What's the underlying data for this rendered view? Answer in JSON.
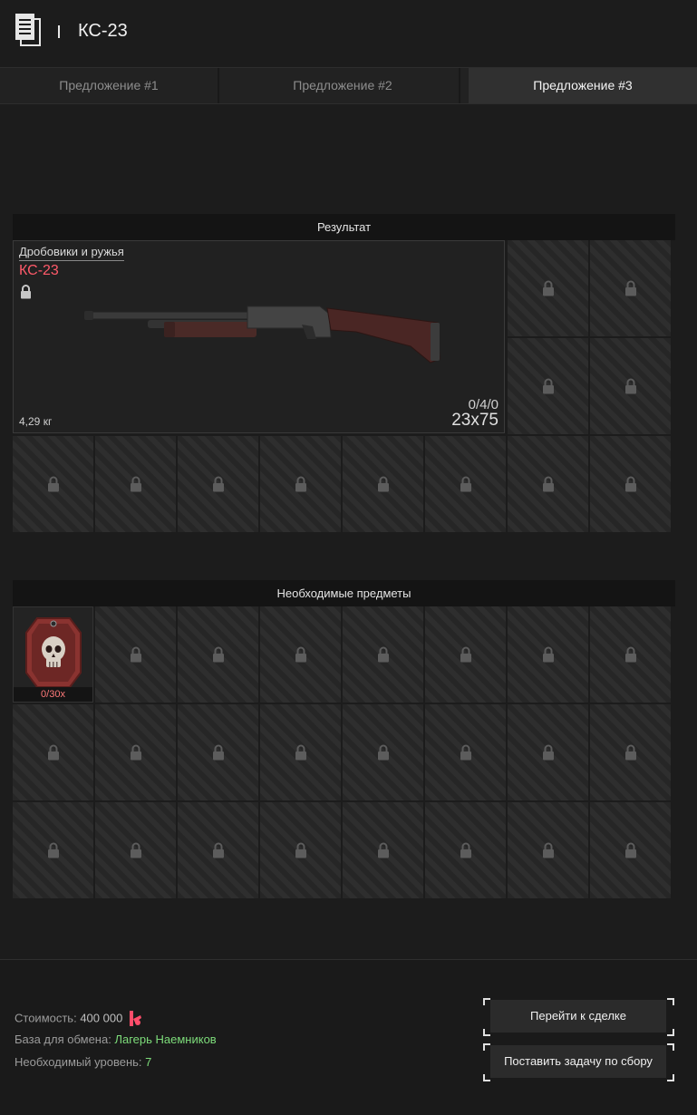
{
  "header": {
    "title": "КС-23",
    "icon": "document-icon"
  },
  "tabs": [
    {
      "label": "Предложение #1",
      "active": false
    },
    {
      "label": "Предложение #2",
      "active": false
    },
    {
      "label": "Предложение #3",
      "active": true
    }
  ],
  "result": {
    "section_title": "Результат",
    "item": {
      "category": "Дробовики и ружья",
      "name": "КС-23",
      "weight": "4,29 кг",
      "ammo_count": "0/4/0",
      "caliber": "23x75",
      "locked": true
    }
  },
  "required": {
    "section_title": "Необходимые предметы",
    "items": [
      {
        "count": "0/30x",
        "icon": "dogtag-skull-icon"
      }
    ]
  },
  "footer": {
    "cost_label": "Стоимость:",
    "cost_value": "400 000",
    "currency_icon": "ruble-icon",
    "base_label": "База для обмена:",
    "base_value": "Лагерь Наемников",
    "level_label": "Необходимый уровень:",
    "level_value": "7"
  },
  "buttons": {
    "goto_deal": "Перейти к сделке",
    "set_task": "Поставить задачу по сбору"
  },
  "colors": {
    "accent_red": "#ff5a6a",
    "accent_green": "#7ddc7a",
    "background": "#1c1c1c"
  }
}
